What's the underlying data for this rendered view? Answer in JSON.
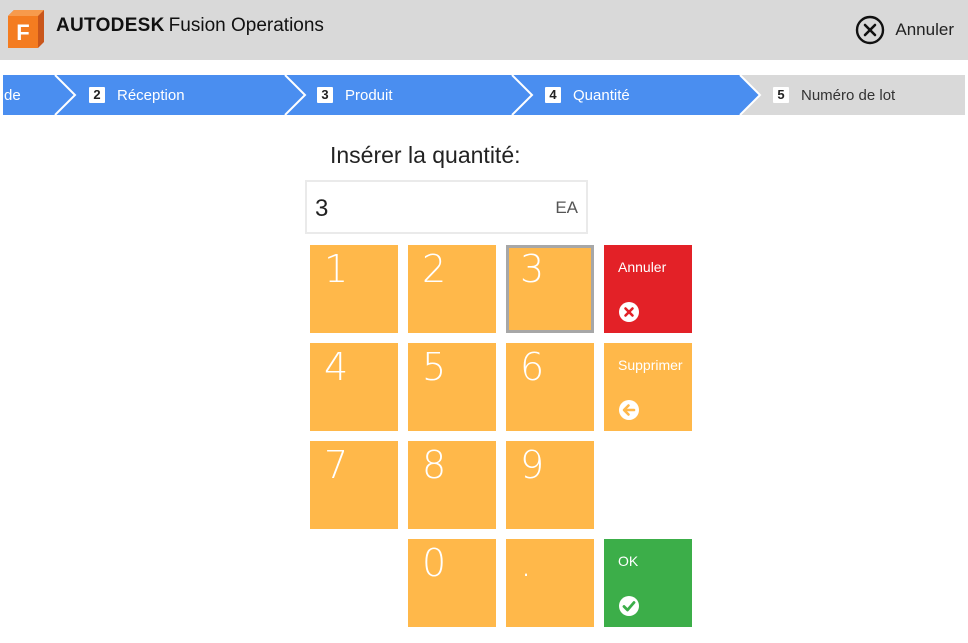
{
  "header": {
    "brand_bold": "AUTODESK",
    "brand_product": "Fusion Operations",
    "logo_letter": "F",
    "cancel_label": "Annuler"
  },
  "steps": [
    {
      "number": "",
      "label": "de",
      "state": "done"
    },
    {
      "number": "2",
      "label": "Réception",
      "state": "done"
    },
    {
      "number": "3",
      "label": "Produit",
      "state": "done"
    },
    {
      "number": "4",
      "label": "Quantité",
      "state": "active"
    },
    {
      "number": "5",
      "label": "Numéro de lot",
      "state": "upcoming"
    }
  ],
  "form": {
    "title": "Insérer la quantité:",
    "value": "3",
    "unit": "EA"
  },
  "keypad": {
    "digits": [
      "1",
      "2",
      "3",
      "4",
      "5",
      "6",
      "7",
      "8",
      "9",
      "0",
      "."
    ],
    "selected_key": "3",
    "cancel_label": "Annuler",
    "delete_label": "Supprimer",
    "ok_label": "OK"
  },
  "colors": {
    "header_bg": "#d9d9d9",
    "step_active": "#4a8ef0",
    "step_inactive": "#d9d9d9",
    "key": "#ffb84a",
    "cancel": "#e32127",
    "ok": "#3cae49"
  }
}
